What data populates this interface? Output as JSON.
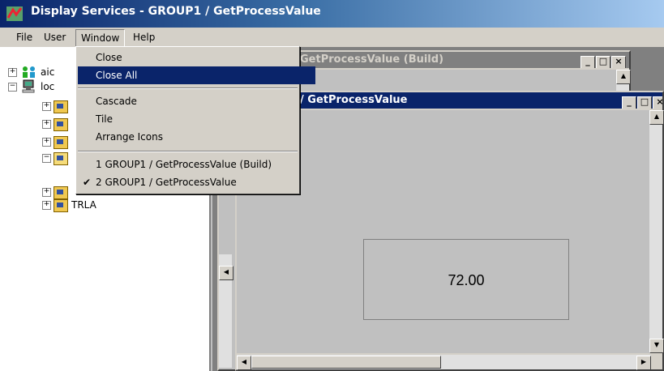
{
  "app": {
    "title": "Display Services - GROUP1 / GetProcessValue"
  },
  "menubar": {
    "items": [
      "File",
      "User",
      "Window",
      "Help"
    ]
  },
  "window_menu": {
    "items": [
      {
        "label": "Close"
      },
      {
        "label": "Close All",
        "highlighted": true
      },
      {
        "label": "Cascade"
      },
      {
        "label": "Tile"
      },
      {
        "label": "Arrange Icons"
      },
      {
        "label": "1 GROUP1 / GetProcessValue (Build)"
      },
      {
        "label": "2 GROUP1 / GetProcessValue",
        "checked": true
      }
    ],
    "check_mark": "✔"
  },
  "tree": {
    "items": [
      {
        "label": "aic",
        "icon": "users-icon"
      },
      {
        "label": "loc",
        "icon": "computer-icon"
      },
      {
        "label": "",
        "icon": "folder-icon"
      },
      {
        "label": "",
        "icon": "folder-icon"
      },
      {
        "label": "",
        "icon": "folder-icon"
      },
      {
        "label": "",
        "icon": "folder-open-icon"
      },
      {
        "label": "",
        "icon": "folder-icon"
      },
      {
        "label": "TRLA",
        "icon": "folder-icon"
      }
    ]
  },
  "windows": {
    "build": {
      "title": "GetProcessValue (Build)"
    },
    "main": {
      "title": "/ GetProcessValue",
      "value": "72.00"
    }
  },
  "buttons": {
    "minimize": "_",
    "maximize": "□",
    "close": "×"
  }
}
